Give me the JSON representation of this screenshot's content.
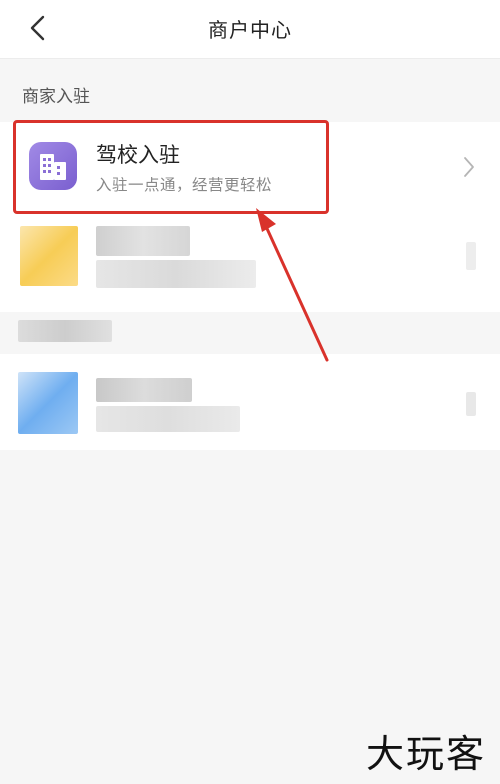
{
  "navbar": {
    "title": "商户中心",
    "back_icon": "chevron-left-icon"
  },
  "section": {
    "label": "商家入驻"
  },
  "entries": [
    {
      "title": "驾校入驻",
      "subtitle": "入驻一点通，经营更轻松",
      "icon": "building-icon",
      "icon_color": "#8b6fd6"
    }
  ],
  "annotation": {
    "highlight_color": "#d9322b",
    "arrow_color": "#d9322b"
  },
  "watermark": {
    "text": "大玩客"
  }
}
